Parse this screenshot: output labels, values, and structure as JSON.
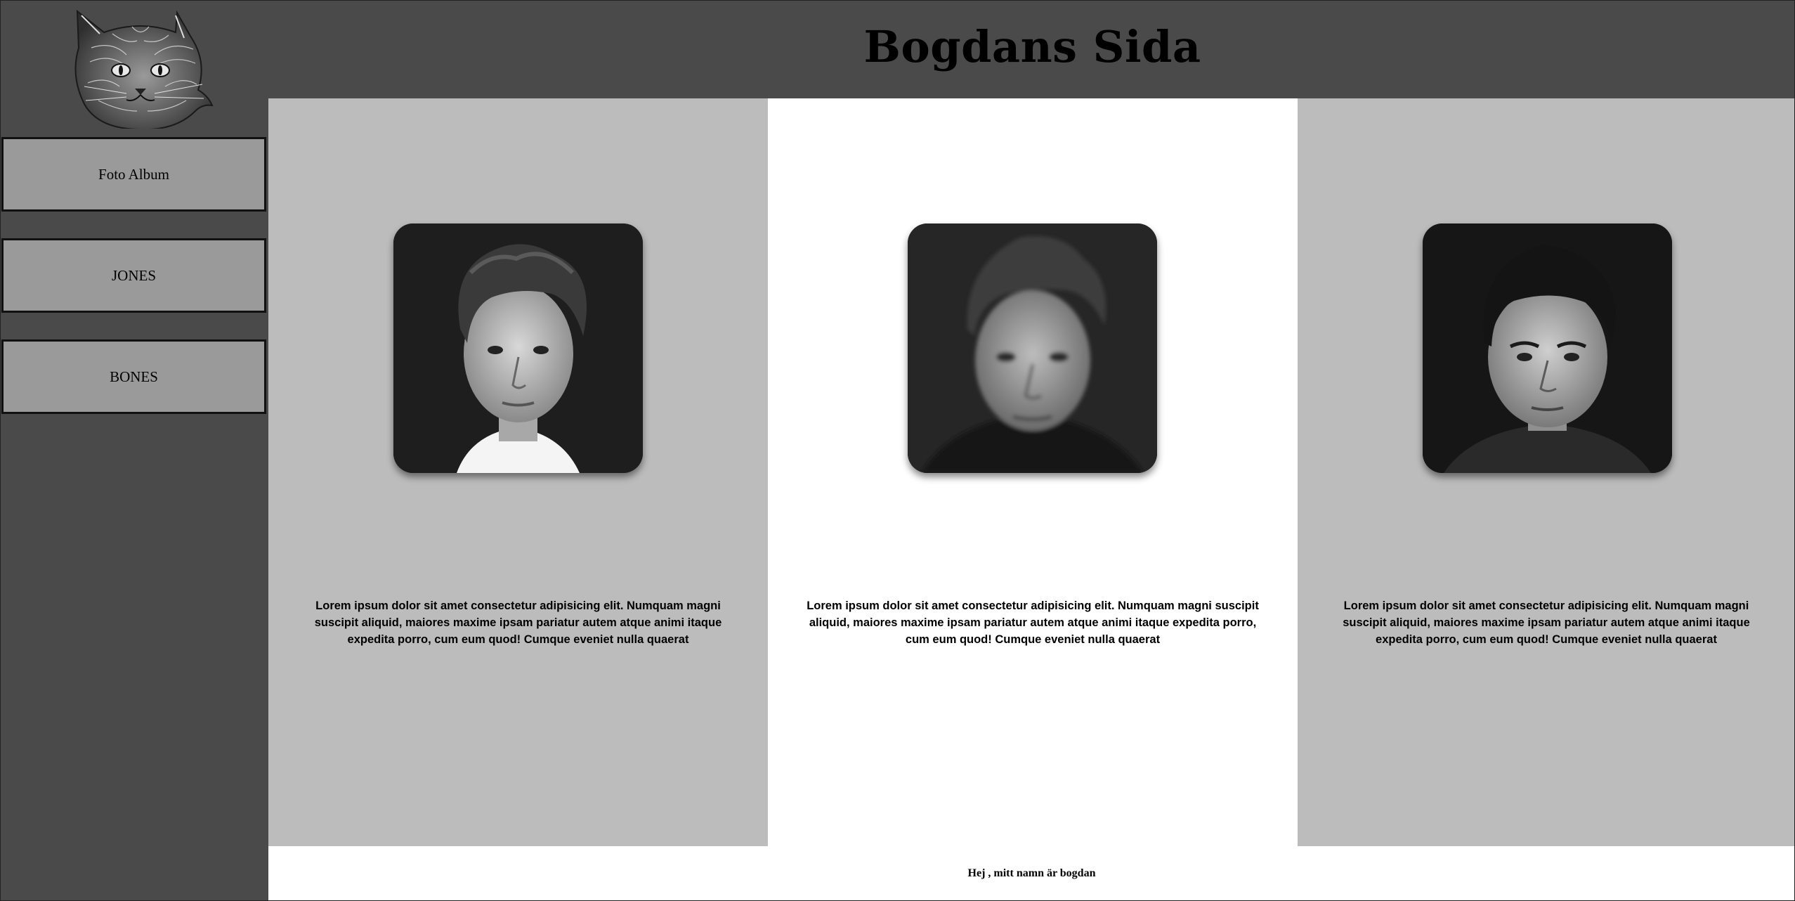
{
  "header": {
    "title": "Bogdans Sida",
    "logo": "cat-sketch-logo"
  },
  "sidebar": {
    "items": [
      {
        "label": "Foto Album"
      },
      {
        "label": "JONES"
      },
      {
        "label": "BONES"
      }
    ]
  },
  "columns": [
    {
      "text": "Lorem ipsum dolor sit amet consectetur adipisicing elit. Numquam magni suscipit aliquid, maiores maxime ipsam pariatur autem atque animi itaque expedita porro, cum eum quod! Cumque eveniet nulla quaerat"
    },
    {
      "text": "Lorem ipsum dolor sit amet consectetur adipisicing elit. Numquam magni suscipit aliquid, maiores maxime ipsam pariatur autem atque animi itaque expedita porro, cum eum quod! Cumque eveniet nulla quaerat"
    },
    {
      "text": "Lorem ipsum dolor sit amet consectetur adipisicing elit. Numquam magni suscipit aliquid, maiores maxime ipsam pariatur autem atque animi itaque expedita porro, cum eum quod! Cumque eveniet nulla quaerat"
    }
  ],
  "footer": {
    "text": "Hej , mitt namn är bogdan"
  },
  "colors": {
    "chrome": "#4a4a4a",
    "column_gray": "#bcbcbc",
    "button": "#9a9a9a",
    "border": "#111111"
  }
}
